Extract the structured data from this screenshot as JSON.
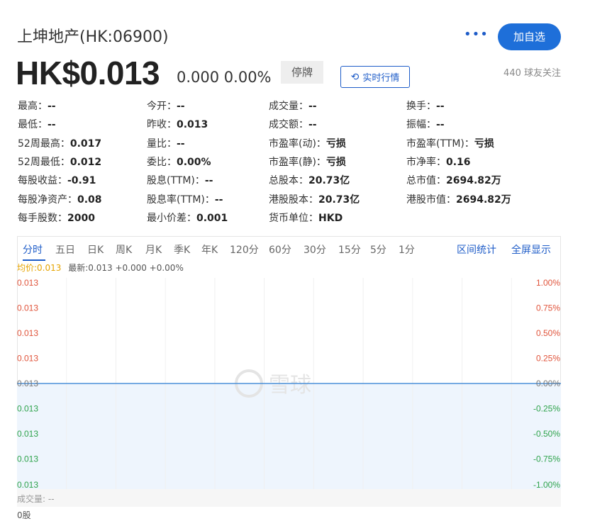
{
  "header": {
    "title": "上坤地产(HK:06900)",
    "more_icon": "more-icon",
    "add_button": "加自选",
    "price": "HK$0.013",
    "change": "0.000 0.00%",
    "halt_badge": "停牌",
    "realtime_button": "实时行情",
    "followers": "440 球友关注"
  },
  "stats": [
    [
      {
        "label": "最高：",
        "value": "--"
      },
      {
        "label": "今开：",
        "value": "--"
      },
      {
        "label": "成交量：",
        "value": "--"
      },
      {
        "label": "换手：",
        "value": "--"
      }
    ],
    [
      {
        "label": "最低：",
        "value": "--"
      },
      {
        "label": "昨收：",
        "value": "0.013"
      },
      {
        "label": "成交额：",
        "value": "--"
      },
      {
        "label": "振幅：",
        "value": "--"
      }
    ],
    [
      {
        "label": "52周最高：",
        "value": "0.017"
      },
      {
        "label": "量比：",
        "value": "--"
      },
      {
        "label": "市盈率(动)：",
        "value": "亏损"
      },
      {
        "label": "市盈率(TTM)：",
        "value": "亏损"
      }
    ],
    [
      {
        "label": "52周最低：",
        "value": "0.012"
      },
      {
        "label": "委比：",
        "value": "0.00%"
      },
      {
        "label": "市盈率(静)：",
        "value": "亏损"
      },
      {
        "label": "市净率：",
        "value": "0.16"
      }
    ],
    [
      {
        "label": "每股收益：",
        "value": "-0.91"
      },
      {
        "label": "股息(TTM)：",
        "value": "--"
      },
      {
        "label": "总股本：",
        "value": "20.73亿"
      },
      {
        "label": "总市值：",
        "value": "2694.82万"
      }
    ],
    [
      {
        "label": "每股净资产：",
        "value": "0.08"
      },
      {
        "label": "股息率(TTM)：",
        "value": "--"
      },
      {
        "label": "港股股本：",
        "value": "20.73亿"
      },
      {
        "label": "港股市值：",
        "value": "2694.82万"
      }
    ],
    [
      {
        "label": "每手股数：",
        "value": "2000"
      },
      {
        "label": "最小价差：",
        "value": "0.001"
      },
      {
        "label": "货币单位：",
        "value": "HKD"
      }
    ]
  ],
  "tabs": [
    "分时",
    "五日",
    "日K",
    "周K",
    "月K",
    "季K",
    "年K",
    "120分",
    "60分",
    "30分",
    "15分",
    "5分",
    "1分"
  ],
  "active_tab": "分时",
  "tabs_right": [
    "区间统计",
    "全屏显示"
  ],
  "info_line": {
    "avg": "均价:0.013",
    "latest": "最新:0.013 +0.000 +0.00%"
  },
  "chart_data": {
    "type": "line",
    "left_ticks": [
      "0.013",
      "0.013",
      "0.013",
      "0.013",
      "0.013",
      "0.013",
      "0.013",
      "0.013",
      "0.013"
    ],
    "right_ticks": [
      "1.00%",
      "0.75%",
      "0.50%",
      "0.25%",
      "0.00%",
      "-0.25%",
      "-0.50%",
      "-0.75%",
      "-1.00%"
    ],
    "y_percent_range": [
      -1.0,
      1.0
    ],
    "series": [
      {
        "values": [
          0.0
        ]
      }
    ],
    "watermark": "雪球",
    "colors": {
      "up": "#e0533a",
      "down": "#2ea34b",
      "flat": "#777777",
      "line": "#4a90d9",
      "fill": "#eef5fd"
    }
  },
  "volume": {
    "label": "成交量: --",
    "value": "0股"
  }
}
